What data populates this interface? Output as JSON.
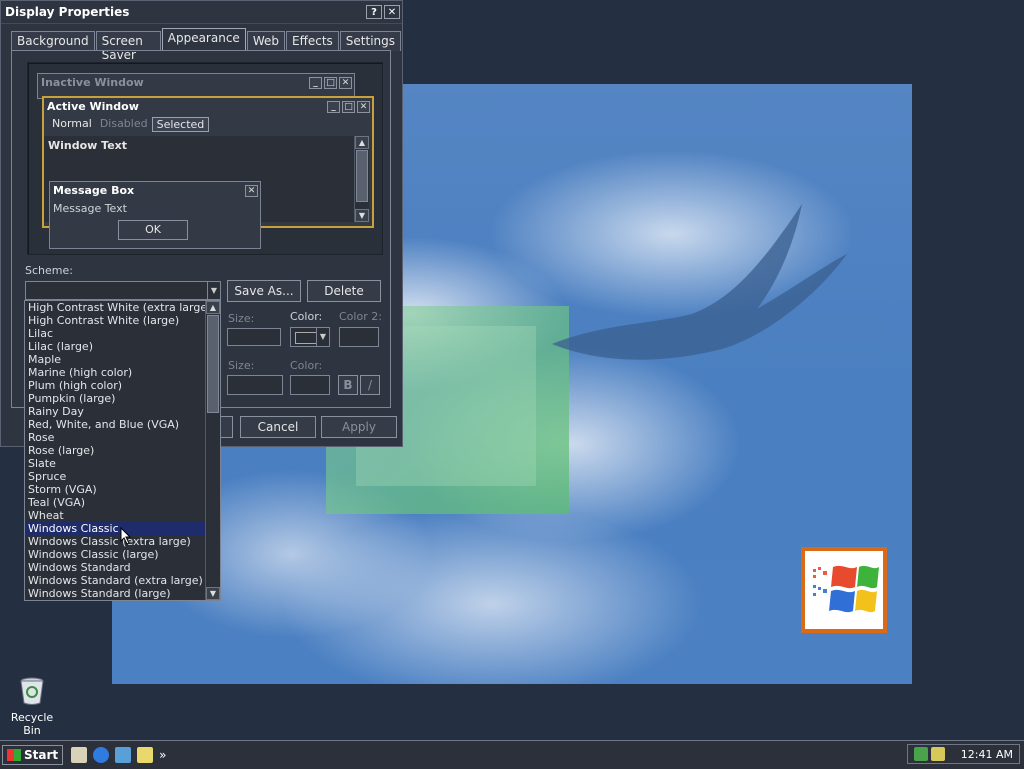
{
  "dialog": {
    "title": "Display Properties",
    "help_glyph": "?",
    "close_glyph": "✕",
    "tabs": [
      {
        "label": "Background"
      },
      {
        "label": "Screen Saver"
      },
      {
        "label": "Appearance"
      },
      {
        "label": "Web"
      },
      {
        "label": "Effects"
      },
      {
        "label": "Settings"
      }
    ],
    "active_tab": "Appearance"
  },
  "preview": {
    "inactive_title": "Inactive Window",
    "active_title": "Active Window",
    "menu": {
      "normal": "Normal",
      "disabled": "Disabled",
      "selected": "Selected"
    },
    "window_text": "Window Text",
    "message_box_title": "Message Box",
    "message_text": "Message Text",
    "ok_label": "OK"
  },
  "scheme": {
    "label": "Scheme:",
    "value": "",
    "save_as_label": "Save As...",
    "delete_label": "Delete",
    "options": [
      "High Contrast White (extra large)",
      "High Contrast White (large)",
      "Lilac",
      "Lilac (large)",
      "Maple",
      "Marine (high color)",
      "Plum (high color)",
      "Pumpkin (large)",
      "Rainy Day",
      "Red, White, and Blue (VGA)",
      "Rose",
      "Rose (large)",
      "Slate",
      "Spruce",
      "Storm (VGA)",
      "Teal (VGA)",
      "Wheat",
      "Windows Classic",
      "Windows Classic (extra large)",
      "Windows Classic (large)",
      "Windows Standard",
      "Windows Standard (extra large)",
      "Windows Standard (large)"
    ],
    "highlighted": "Windows Classic"
  },
  "item_controls": {
    "size_label": "Size:",
    "color_label": "Color:",
    "color2_label": "Color 2:",
    "font_size_label": "Size:",
    "font_color_label": "Color:",
    "bold_label": "B",
    "italic_label": "/"
  },
  "buttons": {
    "cancel": "Cancel",
    "apply": "Apply"
  },
  "desktop": {
    "recycle_bin_label": "Recycle Bin"
  },
  "taskbar": {
    "start_label": "Start",
    "chevron": "»",
    "clock": "12:41 AM"
  },
  "colors": {
    "dialog_bg": "#2e3440",
    "selection": "#1e2c6b",
    "active_title_border": "#c8a13a",
    "logo_border": "#d86a18"
  }
}
